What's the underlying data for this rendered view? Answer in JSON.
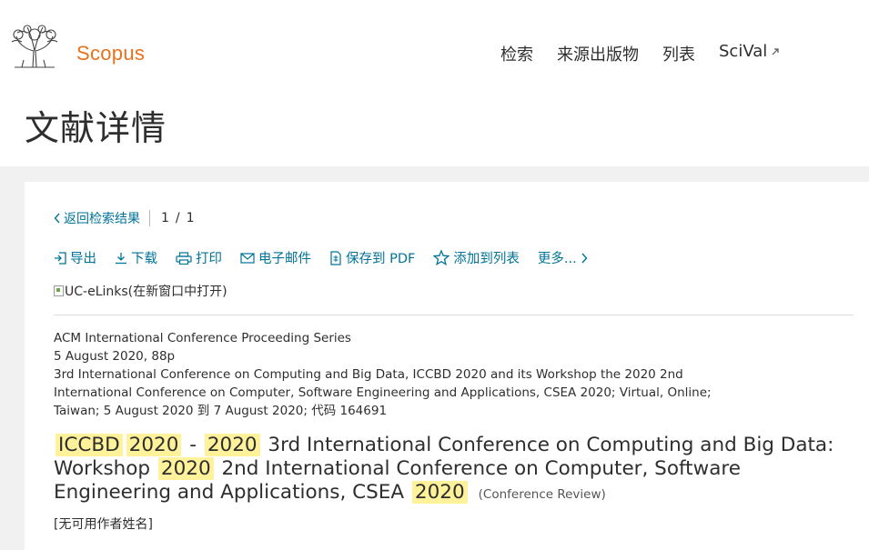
{
  "header": {
    "brand": "Scopus",
    "nav": {
      "search": "检索",
      "sources": "来源出版物",
      "lists": "列表",
      "scival": "SciVal"
    }
  },
  "page_title": "文献详情",
  "result_nav": {
    "back_label": "返回检索结果",
    "current": "1",
    "separator": "/",
    "total": "1"
  },
  "actions": {
    "export": "导出",
    "download": "下载",
    "print": "打印",
    "email": "电子邮件",
    "save_pdf": "保存到 PDF",
    "add_to_list": "添加到列表",
    "more": "更多..."
  },
  "elinks_alt": "UC-eLinks(在新窗口中打开)",
  "source": {
    "series": "ACM International Conference Proceeding Series",
    "date_pages": "5 August 2020, 88p",
    "conference_line1": "3rd International Conference on Computing and Big Data, ICCBD 2020 and its Workshop the 2020 2nd",
    "conference_line2": "International Conference on Computer, Software Engineering and Applications, CSEA 2020; Virtual, Online;",
    "conference_line3": "Taiwan; 5 August 2020 到 7 August 2020; 代码 164691"
  },
  "document": {
    "title_parts": {
      "p1": "ICCBD",
      "p2": "2020",
      "p3": "-",
      "p4": "2020",
      "p5": "3rd International Conference on Computing and Big Data: Workshop",
      "p6": "2020",
      "p7": "2nd International Conference on Computer, Software Engineering and Applications, CSEA",
      "p8": "2020"
    },
    "type": "(Conference Review)",
    "authors": "[无可用作者姓名]"
  },
  "colors": {
    "brand": "#e9711c",
    "link": "#007398",
    "highlight": "#fff29a"
  }
}
